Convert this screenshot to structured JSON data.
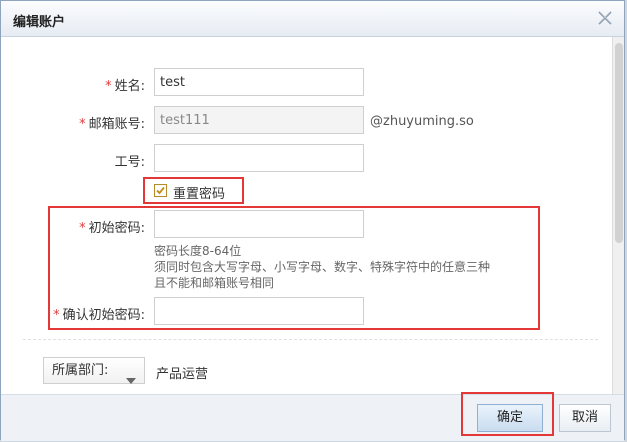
{
  "dialog": {
    "title": "编辑账户"
  },
  "form": {
    "required_mark": "*",
    "name": {
      "label": "姓名:",
      "value": "test"
    },
    "email": {
      "label": "邮箱账号:",
      "value": "test111",
      "suffix": "@zhuyuming.so"
    },
    "employee_id": {
      "label": "工号:",
      "value": ""
    },
    "reset_password": {
      "label": "重置密码",
      "checked": true
    },
    "initial_password": {
      "label": "初始密码:",
      "value": ""
    },
    "password_hint": [
      "密码长度8-64位",
      "须同时包含大写字母、小写字母、数字、特殊字符中的任意三种",
      "且不能和邮箱账号相同"
    ],
    "confirm_password": {
      "label": "确认初始密码:",
      "value": ""
    },
    "department": {
      "button_label": "所属部门:",
      "value": "产品运营"
    }
  },
  "footer": {
    "confirm_label": "确定",
    "cancel_label": "取消"
  },
  "colors": {
    "highlight": "#e43838",
    "required": "#e03a3a"
  }
}
